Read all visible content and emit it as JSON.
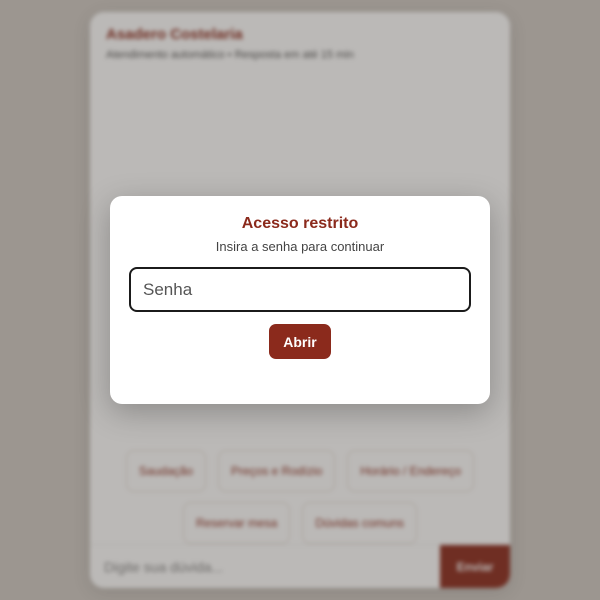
{
  "chat": {
    "title": "Asadero Costelaria",
    "subtitle": "Atendimento automático • Resposta em até 15 min",
    "quick_replies": [
      "Saudação",
      "Preços e Rodízio",
      "Horário / Endereço",
      "Reservar mesa",
      "Dúvidas comuns"
    ],
    "composer_placeholder": "Digite sua dúvida...",
    "send_label": "Enviar"
  },
  "modal": {
    "title": "Acesso restrito",
    "subtitle": "Insira a senha para continuar",
    "password_placeholder": "Senha",
    "password_value": "",
    "open_label": "Abrir"
  },
  "colors": {
    "accent": "#8b2a1c",
    "backdrop": "#cfc9c3",
    "card": "#ffffff"
  }
}
